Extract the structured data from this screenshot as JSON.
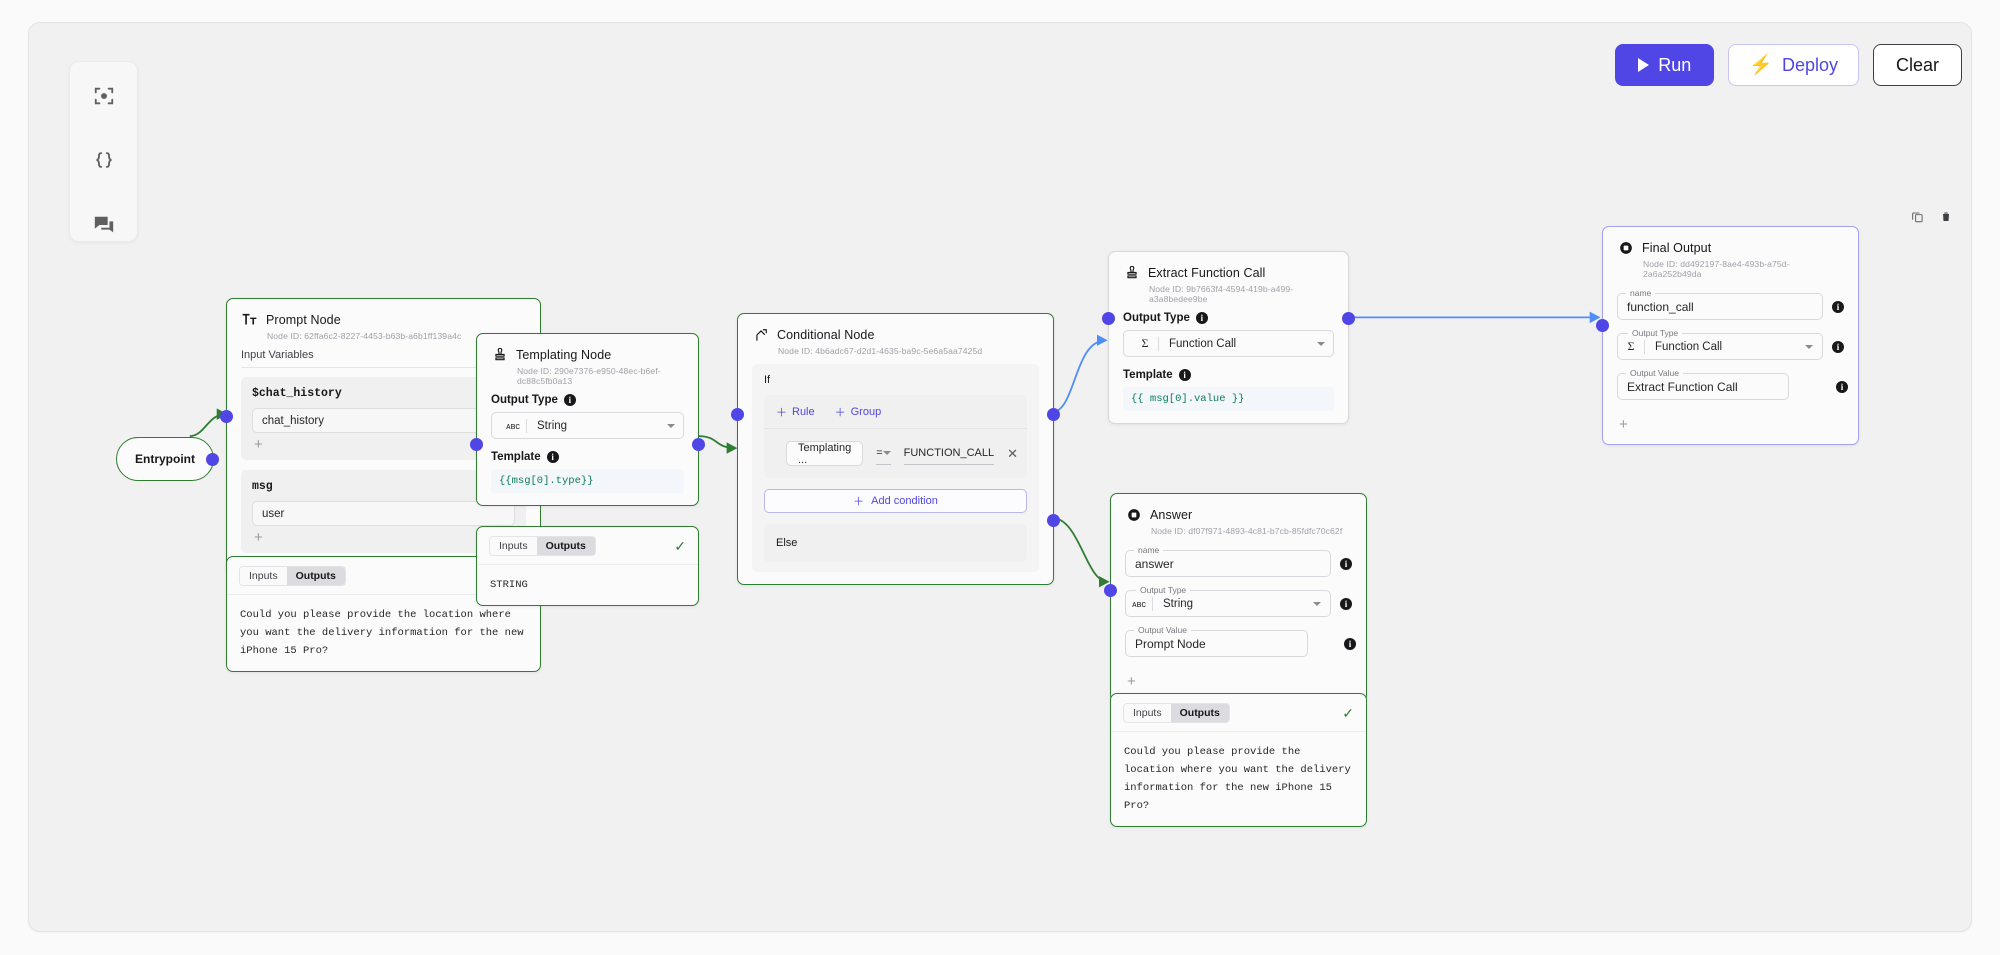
{
  "toolbar": {
    "run_label": "Run",
    "deploy_label": "Deploy",
    "clear_label": "Clear",
    "accent_indigo": "#4f46e5",
    "node_green": "#2e7d32"
  },
  "palette": {
    "items": [
      {
        "icon": "focus-target-icon",
        "name": "focus-tool"
      },
      {
        "icon": "curly-braces-icon",
        "name": "variables-tool"
      },
      {
        "icon": "chat-bubbles-icon",
        "name": "chat-tool"
      }
    ]
  },
  "node_actions": {
    "copy_icon": "copy-icon",
    "delete_icon": "trash-icon"
  },
  "entrypoint": {
    "label": "Entrypoint"
  },
  "nodes": {
    "prompt": {
      "title": "Prompt Node",
      "icon": "text-format-icon",
      "node_id": "Node ID: 62ffa6c2-8227-4453-b63b-a6b1ff139a4c",
      "section_label": "Input Variables",
      "variables": [
        {
          "name": "$chat_history",
          "value": "chat_history",
          "add_label": "+"
        },
        {
          "name": "msg",
          "value": "user",
          "add_label": "+"
        }
      ]
    },
    "prompt_io": {
      "tab_inputs": "Inputs",
      "tab_outputs": "Outputs",
      "status": "✓",
      "text": "Could you please provide the location where you want the delivery information for the new iPhone 15 Pro?"
    },
    "templating": {
      "title": "Templating Node",
      "icon": "stamp-icon",
      "node_id": "Node ID: 290e7376-e950-48ec-b6ef-dc88c5fb0a13",
      "output_type_label": "Output Type",
      "output_type_value": "String",
      "output_type_icon": "abc-icon",
      "template_label": "Template",
      "template_value": "{{msg[0].type}}"
    },
    "templating_io": {
      "tab_inputs": "Inputs",
      "tab_outputs": "Outputs",
      "status": "✓",
      "text": "STRING"
    },
    "conditional": {
      "title": "Conditional Node",
      "icon": "branch-icon",
      "node_id": "Node ID: 4b6adc67-d2d1-4635-ba9c-5e6a5aa7425d",
      "if_label": "If",
      "rule_label": "Rule",
      "group_label": "Group",
      "rule": {
        "left": "Templating ...",
        "operator": "=",
        "right": "FUNCTION_CALL",
        "remove": "✕"
      },
      "add_condition_label": "Add condition",
      "else_label": "Else"
    },
    "extract": {
      "title": "Extract Function Call",
      "icon": "stamp-icon",
      "node_id": "Node ID: 9b7663f4-4594-419b-a499-a3a8bedee9be",
      "output_type_label": "Output Type",
      "output_type_value": "Function Call",
      "output_type_icon": "sigma-icon",
      "template_label": "Template",
      "template_value": "{{ msg[0].value }}"
    },
    "final_output": {
      "title": "Final Output",
      "icon": "output-square-icon",
      "node_id": "Node ID: dd492197-8ae4-493b-a75d-2a6a252b49da",
      "name_legend": "name",
      "name_value": "function_call",
      "output_type_legend": "Output Type",
      "output_type_value": "Function Call",
      "output_type_icon": "sigma-icon",
      "output_value_legend": "Output Value",
      "output_value_value": "Extract Function Call",
      "add_label": "+"
    },
    "answer": {
      "title": "Answer",
      "icon": "output-square-icon",
      "node_id": "Node ID: df07f971-4893-4c81-b7cb-85fdfc70c62f",
      "name_legend": "name",
      "name_value": "answer",
      "output_type_legend": "Output Type",
      "output_type_value": "String",
      "output_type_icon": "abc-icon",
      "output_value_legend": "Output Value",
      "output_value_value": "Prompt Node",
      "add_label": "+"
    },
    "answer_io": {
      "tab_inputs": "Inputs",
      "tab_outputs": "Outputs",
      "status": "✓",
      "text": "Could you please provide the location where you want the delivery information for the new iPhone 15 Pro?"
    }
  }
}
